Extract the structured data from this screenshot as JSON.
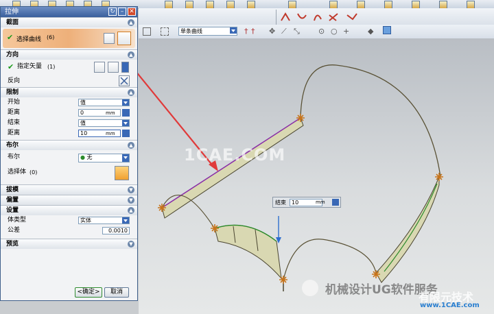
{
  "dialog": {
    "title": "拉伸",
    "sections": {
      "section": "截面",
      "direction": "方向",
      "limits": "限制",
      "boolean": "布尔",
      "draft": "拔模",
      "offset": "偏置",
      "settings": "设置",
      "preview": "预览"
    },
    "section_select": {
      "label": "选择曲线",
      "count": "(6)"
    },
    "direction": {
      "vector_label": "指定矢量",
      "vector_count": "(1)",
      "reverse_label": "反向"
    },
    "limits": {
      "start_label": "开始",
      "start_value": "值",
      "distance1_label": "距离",
      "distance1_value": "0",
      "distance1_unit": "mm",
      "end_label": "结束",
      "end_value": "值",
      "distance2_label": "距离",
      "distance2_value": "10",
      "distance2_unit": "mm"
    },
    "boolean": {
      "label": "布尔",
      "value": "无",
      "select_body_label": "选择体",
      "select_body_count": "(0)"
    },
    "settings": {
      "body_type_label": "体类型",
      "body_type_value": "实体",
      "tolerance_label": "公差",
      "tolerance_value": "0.0010"
    },
    "buttons": {
      "ok": "<确定>",
      "cancel": "取消"
    }
  },
  "toolbar": {
    "curve_filter": "单条曲线"
  },
  "float_input": {
    "label": "结束",
    "value": "10",
    "unit": "mm"
  },
  "watermarks": {
    "center": "1CAE.COM",
    "wechat": "机械设计UG软件服务",
    "footer": "有限元技术",
    "site": "www.1CAE.com"
  },
  "colors": {
    "accent_orange": "#eeb07a",
    "title_blue": "#3a5f9c",
    "arrow_red": "#e03a3a",
    "curve": "#5a5236",
    "surface": "#d9d8b2"
  }
}
